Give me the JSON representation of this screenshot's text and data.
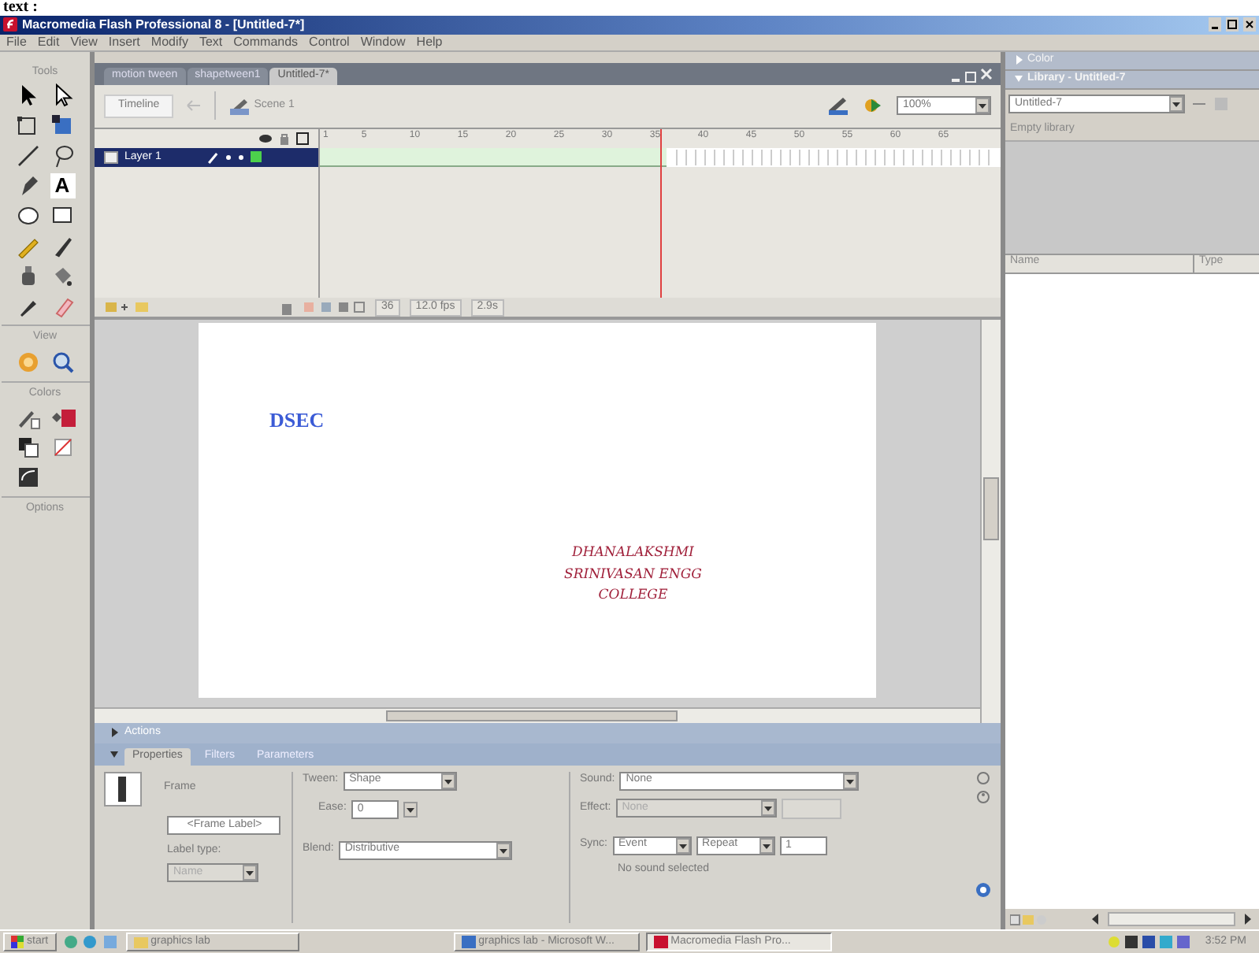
{
  "document_heading": "text :",
  "window": {
    "title": "Macromedia Flash Professional 8 - [Untitled-7*]"
  },
  "menu": [
    "File",
    "Edit",
    "View",
    "Insert",
    "Modify",
    "Text",
    "Commands",
    "Control",
    "Window",
    "Help"
  ],
  "tools": {
    "sections": [
      "Tools",
      "View",
      "Colors",
      "Options"
    ],
    "text_tool_label": "A"
  },
  "document_tabs": [
    {
      "label": "motion tween",
      "selected": false
    },
    {
      "label": "shapetween1",
      "selected": false
    },
    {
      "label": "Untitled-7*",
      "selected": true
    }
  ],
  "edit_bar": {
    "timeline_button": "Timeline",
    "scene": "Scene 1",
    "zoom": "100%"
  },
  "timeline": {
    "frame_numbers": [
      "1",
      "5",
      "10",
      "15",
      "20",
      "25",
      "30",
      "35",
      "40",
      "45",
      "50",
      "55",
      "60",
      "65"
    ],
    "layers": [
      {
        "name": "Layer 1",
        "selected": true
      }
    ],
    "current_frame": "36",
    "frame_rate": "12.0 fps",
    "elapsed": "2.9s"
  },
  "stage": {
    "texts": [
      {
        "kind": "heading",
        "lines": [
          "DSEC"
        ],
        "color": "#3b5bd6"
      },
      {
        "kind": "script",
        "lines": [
          "DHANALAKSHMI",
          "SRINIVASAN ENGG",
          "COLLEGE"
        ],
        "color": "#a0203a"
      }
    ]
  },
  "panel_headers": [
    {
      "title": "Actions",
      "expanded": false
    }
  ],
  "property_tabs": [
    {
      "label": "Properties",
      "selected": true
    },
    {
      "label": "Filters",
      "selected": false
    },
    {
      "label": "Parameters",
      "selected": false
    }
  ],
  "properties": {
    "type_label": "Frame",
    "frame_label_placeholder": "<Frame Label>",
    "label_type_label": "Label type:",
    "label_type": {
      "value": "Name",
      "disabled": true
    },
    "tween_label": "Tween:",
    "tween": "Shape",
    "ease_label": "Ease:",
    "ease": "0",
    "blend_label": "Blend:",
    "blend": "Distributive",
    "sound_label": "Sound:",
    "sound": "None",
    "effect_label": "Effect:",
    "effect": {
      "value": "None",
      "disabled": true
    },
    "sync_label": "Sync:",
    "sync": "Event",
    "repeat": "Repeat",
    "repeat_count": "1",
    "sound_info": "No sound selected"
  },
  "right_panels": [
    {
      "title": "Color",
      "expanded": false
    },
    {
      "title": "Library - Untitled-7",
      "expanded": true
    }
  ],
  "library": {
    "document": "Untitled-7",
    "status": "Empty library",
    "columns": [
      "Name",
      "Type"
    ]
  },
  "taskbar": {
    "start": "start",
    "items": [
      {
        "label": "graphics lab",
        "selected": false
      },
      {
        "label": "graphics lab - Microsoft W...",
        "selected": false
      },
      {
        "label": "Macromedia Flash Pro...",
        "selected": true
      }
    ],
    "clock": "3:52 PM"
  }
}
